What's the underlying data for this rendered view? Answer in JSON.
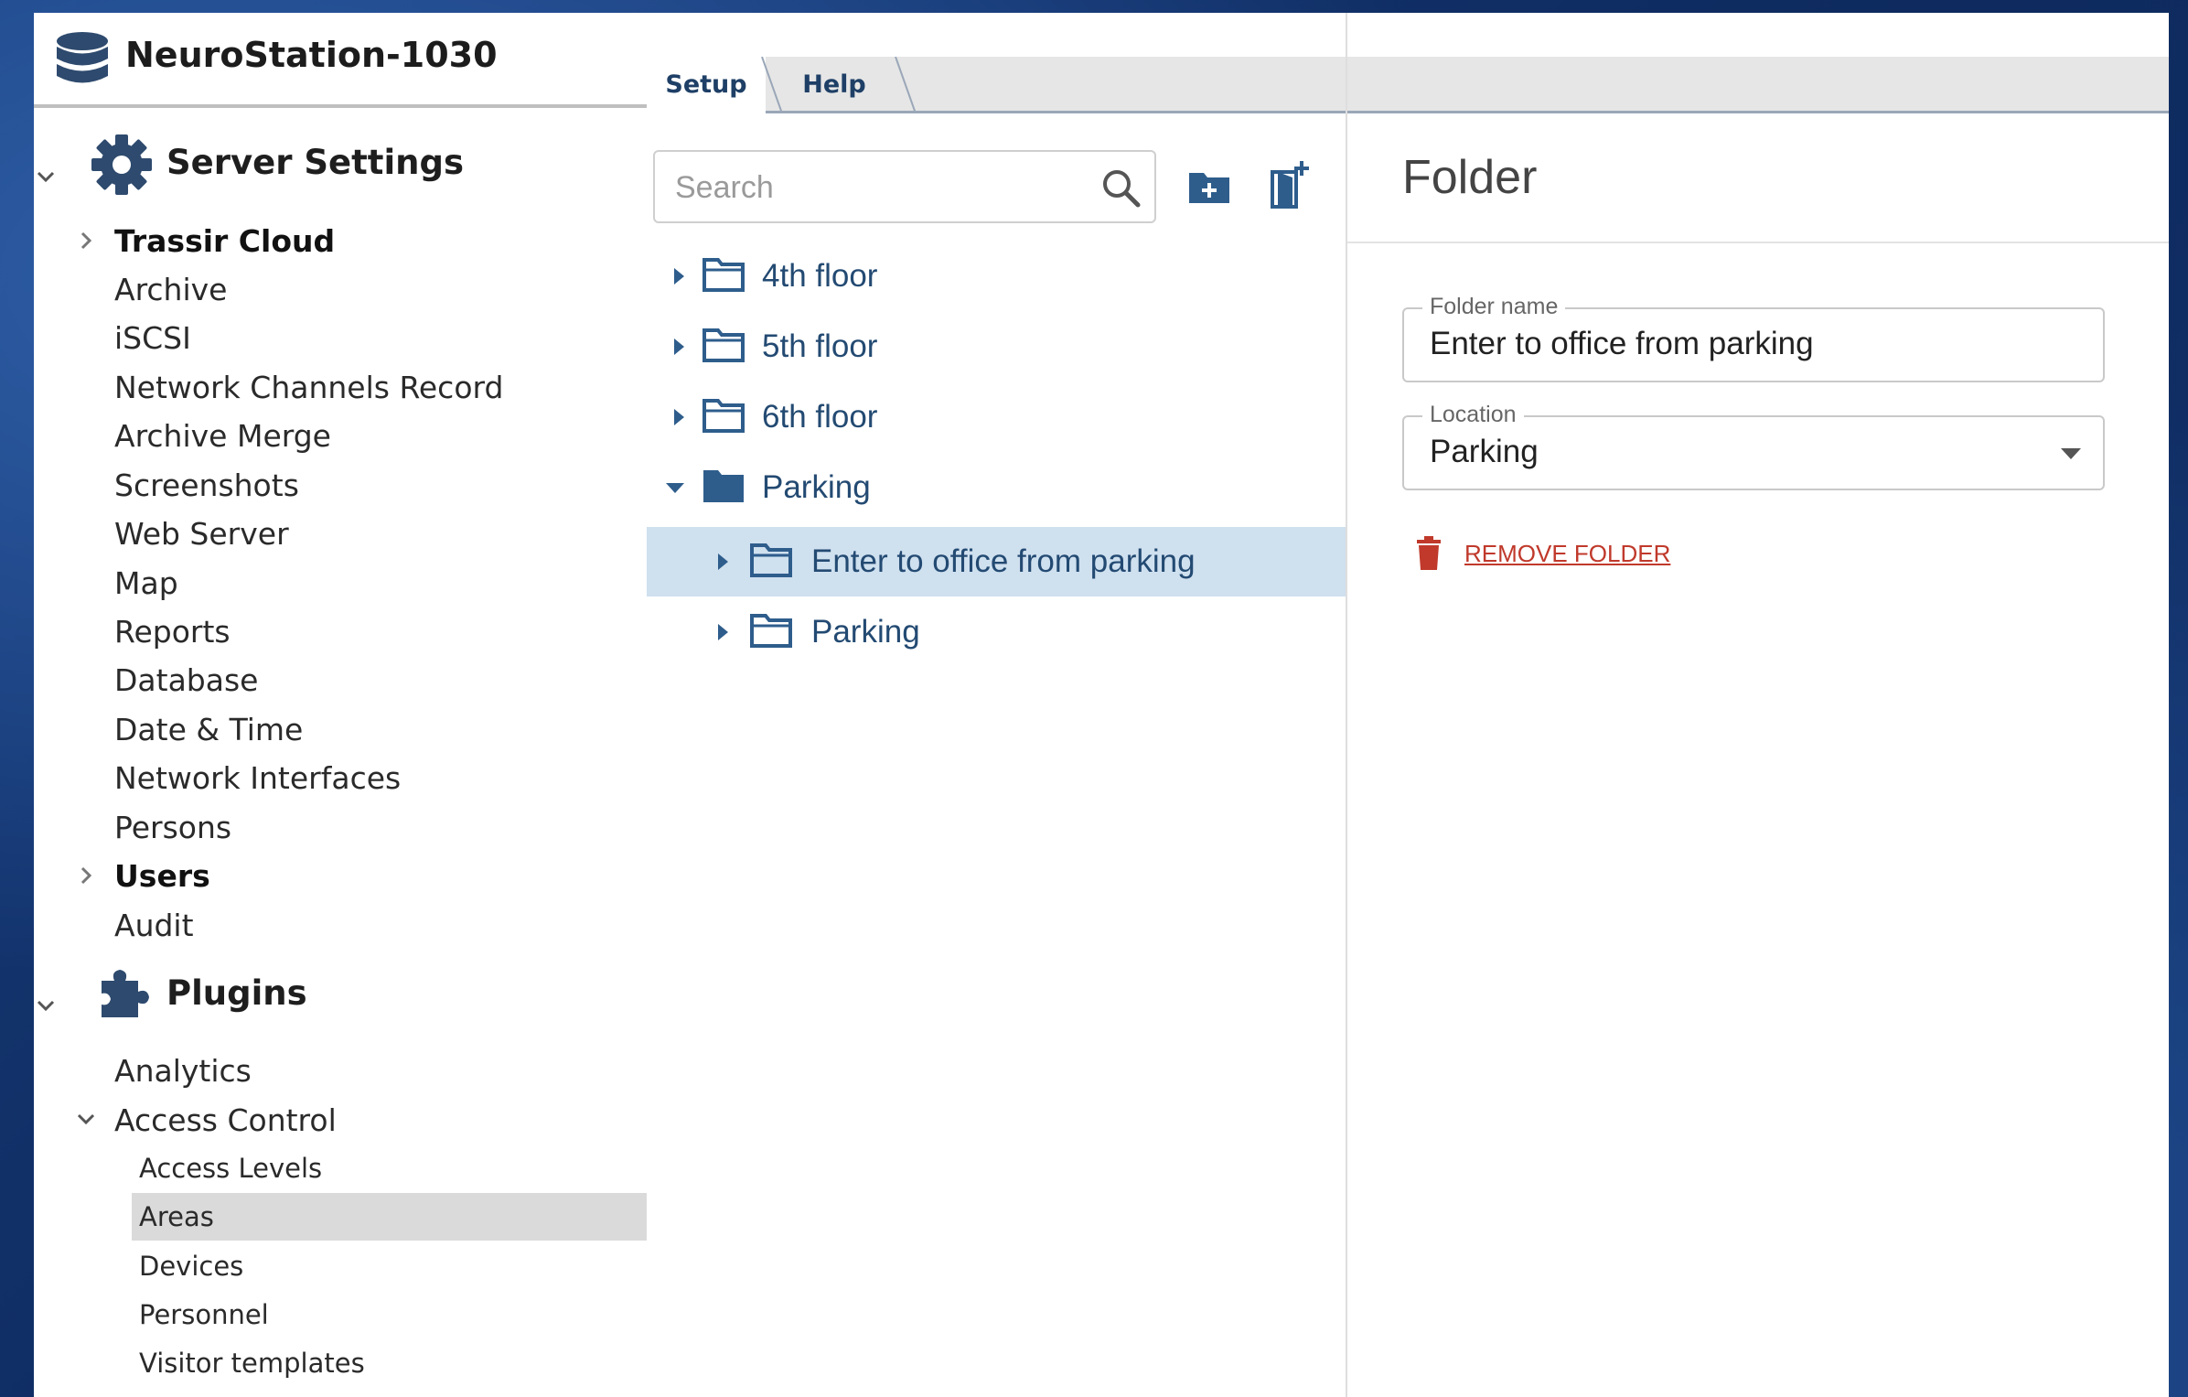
{
  "app": {
    "title": "NeuroStation-1030",
    "icon": "database-icon"
  },
  "sidebar": {
    "server_settings": {
      "label": "Server Settings",
      "icon": "gear-icon",
      "expanded": true,
      "items": [
        {
          "label": "Trassir Cloud",
          "bold": true,
          "expandable": true
        },
        {
          "label": "Archive"
        },
        {
          "label": "iSCSI"
        },
        {
          "label": "Network Channels Record"
        },
        {
          "label": "Archive Merge"
        },
        {
          "label": "Screenshots"
        },
        {
          "label": "Web Server"
        },
        {
          "label": "Map"
        },
        {
          "label": "Reports"
        },
        {
          "label": "Database"
        },
        {
          "label": "Date & Time"
        },
        {
          "label": "Network Interfaces"
        },
        {
          "label": "Persons"
        },
        {
          "label": "Users",
          "bold": true,
          "expandable": true
        },
        {
          "label": "Audit"
        }
      ]
    },
    "plugins": {
      "label": "Plugins",
      "icon": "puzzle-icon",
      "expanded": true,
      "items": [
        {
          "label": "Analytics"
        },
        {
          "label": "Access Control",
          "expanded": true
        }
      ],
      "access_control_items": [
        {
          "label": "Access Levels"
        },
        {
          "label": "Areas",
          "selected": true
        },
        {
          "label": "Devices"
        },
        {
          "label": "Personnel"
        },
        {
          "label": "Visitor templates"
        }
      ]
    }
  },
  "tabs": [
    {
      "label": "Setup",
      "active": true
    },
    {
      "label": "Help",
      "active": false
    }
  ],
  "search": {
    "placeholder": "Search",
    "value": ""
  },
  "tree": [
    {
      "label": "4th floor",
      "expanded": false,
      "depth": 0
    },
    {
      "label": "5th floor",
      "expanded": false,
      "depth": 0
    },
    {
      "label": "6th floor",
      "expanded": false,
      "depth": 0
    },
    {
      "label": "Parking",
      "expanded": true,
      "depth": 0
    },
    {
      "label": "Enter to office from parking",
      "expanded": false,
      "depth": 1,
      "selected": true
    },
    {
      "label": "Parking",
      "expanded": false,
      "depth": 1
    }
  ],
  "details": {
    "title": "Folder",
    "folder_name_label": "Folder name",
    "folder_name_value": "Enter to office from parking",
    "location_label": "Location",
    "location_value": "Parking",
    "remove_label": "REMOVE FOLDER"
  },
  "colors": {
    "accent": "#234a72",
    "selected_row": "#cfe0ef",
    "selected_nav": "#dadada",
    "danger": "#c0392b",
    "background": "#163a78"
  }
}
